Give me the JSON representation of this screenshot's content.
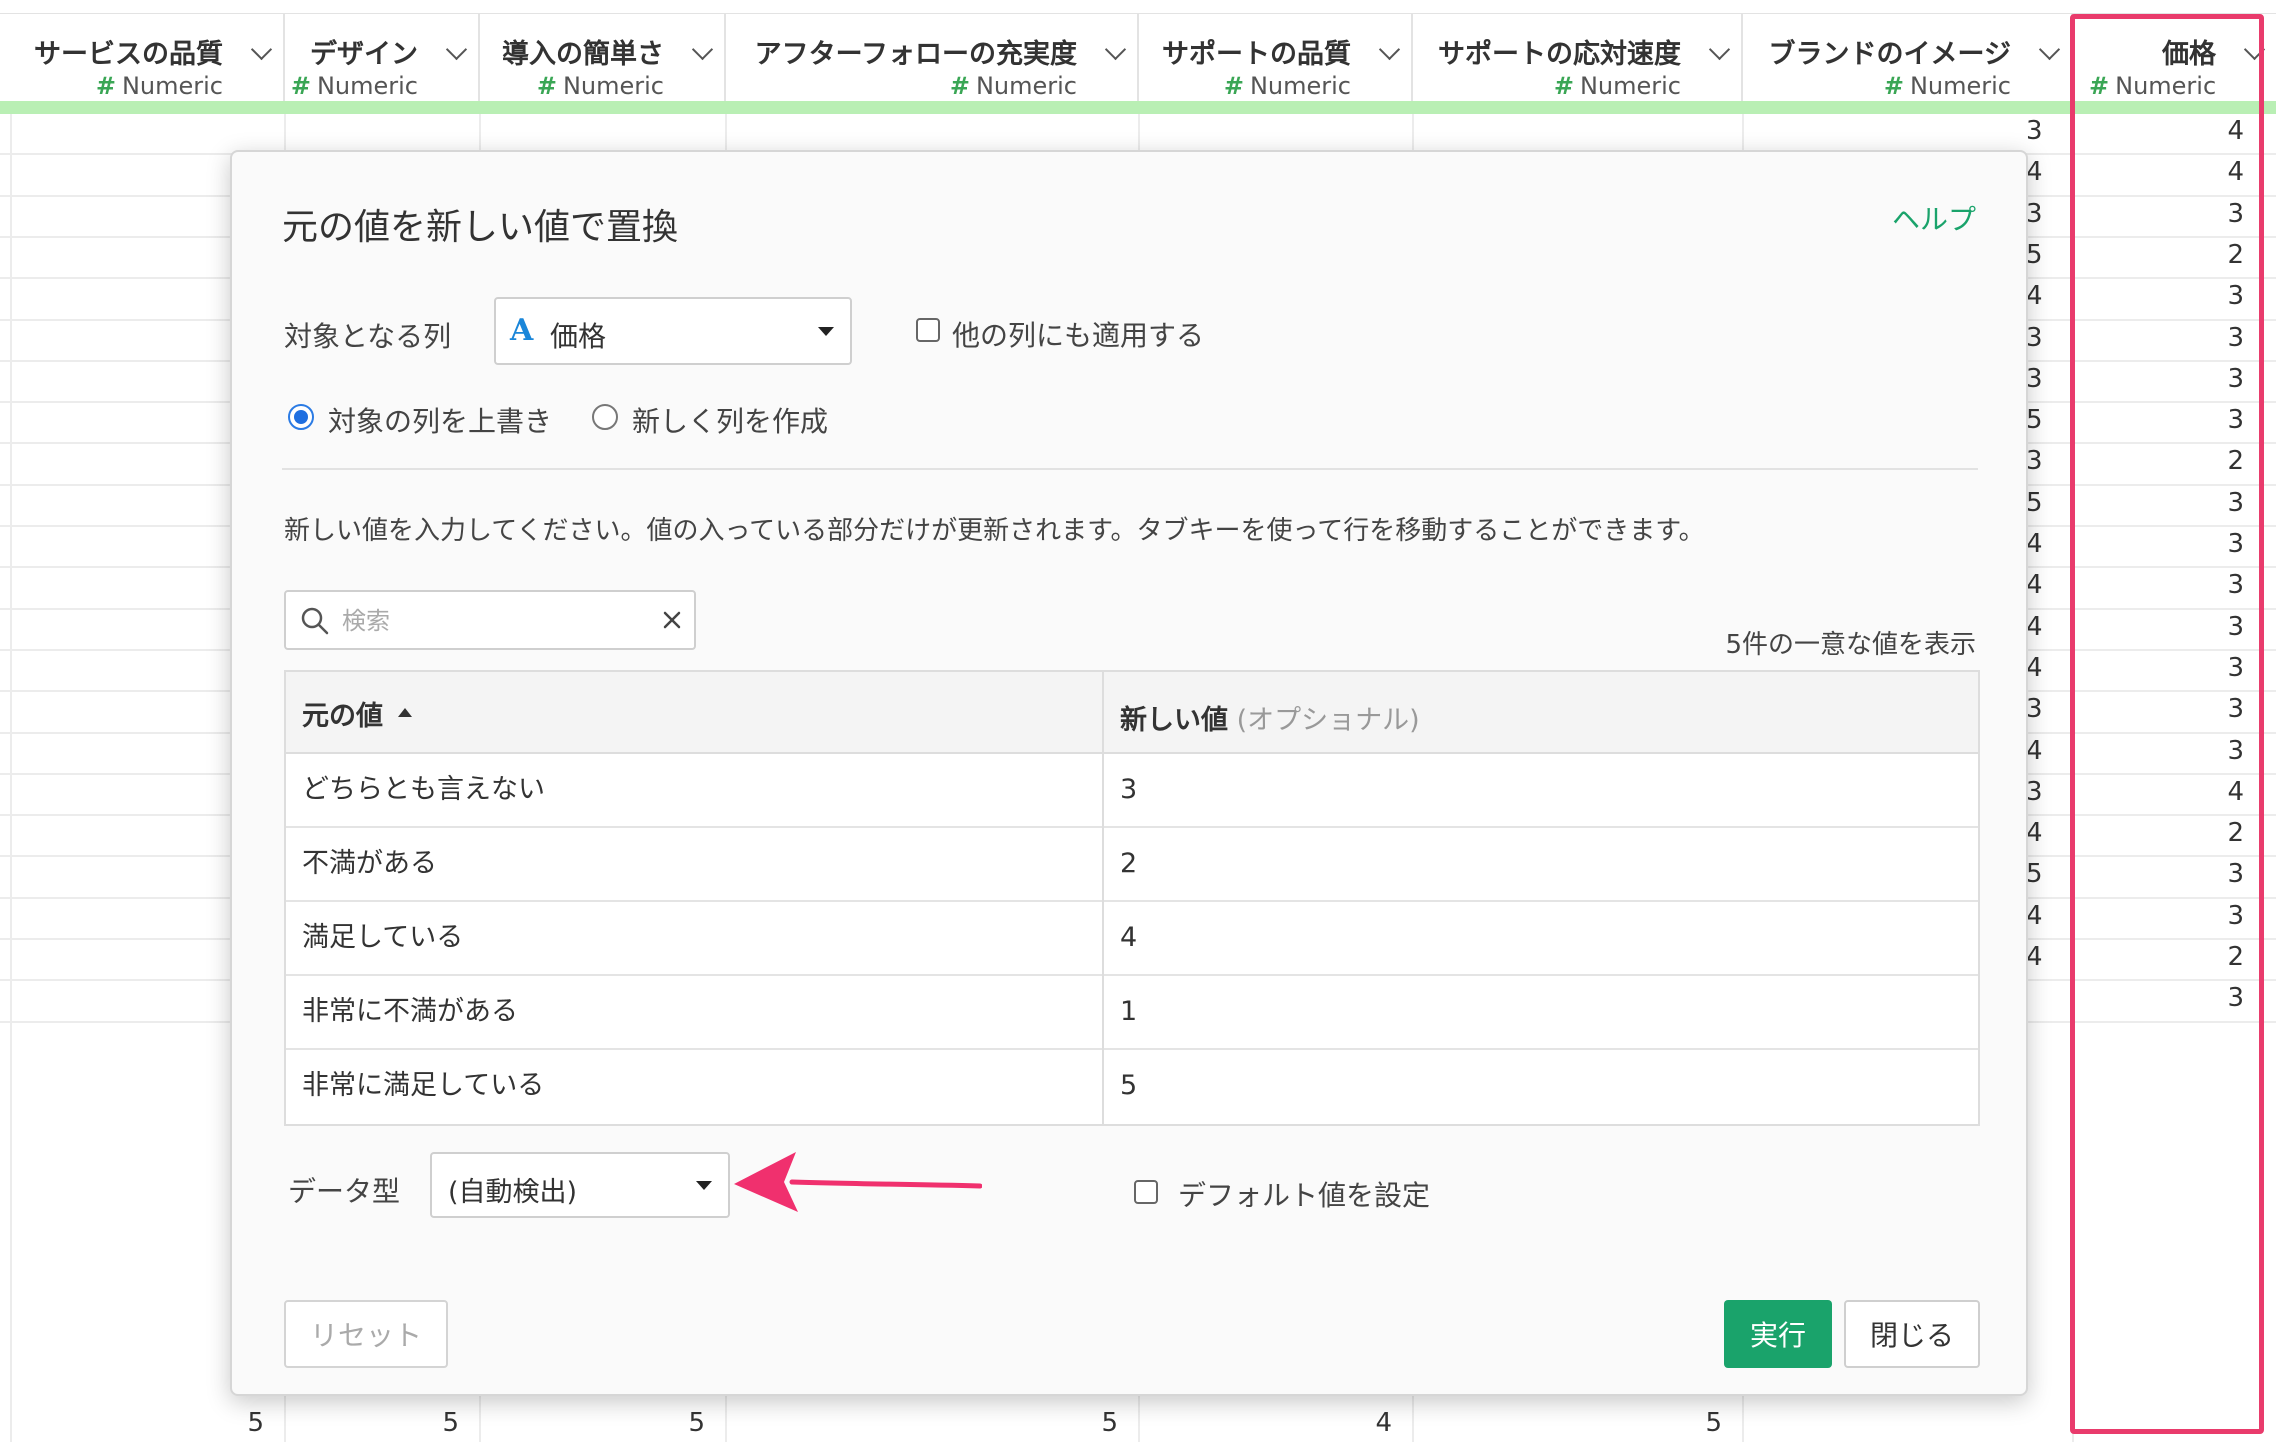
{
  "columns": [
    {
      "name": "サービスの品質",
      "type": "Numeric"
    },
    {
      "name": "デザイン",
      "type": "Numeric"
    },
    {
      "name": "導入の簡単さ",
      "type": "Numeric"
    },
    {
      "name": "アフターフォローの充実度",
      "type": "Numeric"
    },
    {
      "name": "サポートの品質",
      "type": "Numeric"
    },
    {
      "name": "サポートの応対速度",
      "type": "Numeric"
    },
    {
      "name": "ブランドのイメージ",
      "type": "Numeric"
    },
    {
      "name": "価格",
      "type": "Numeric"
    }
  ],
  "type_symbol": "#",
  "brand_column_values": [
    "3",
    "4",
    "3",
    "5",
    "4",
    "3",
    "3",
    "5",
    "3",
    "5",
    "4",
    "4",
    "4",
    "4",
    "3",
    "4",
    "3",
    "4",
    "5",
    "4",
    "4"
  ],
  "price_column_values": [
    "4",
    "4",
    "3",
    "2",
    "3",
    "3",
    "3",
    "3",
    "2",
    "3",
    "3",
    "3",
    "3",
    "3",
    "3",
    "3",
    "4",
    "2",
    "3",
    "3",
    "2",
    "3"
  ],
  "bottom_row": [
    "5",
    "5",
    "5",
    "5",
    "4",
    "5"
  ],
  "dialog": {
    "title": "元の値を新しい値で置換",
    "help": "ヘルプ",
    "target_column_label": "対象となる列",
    "target_column_type_icon": "A",
    "target_column_value": "価格",
    "apply_other_columns": "他の列にも適用する",
    "radio_overwrite": "対象の列を上書き",
    "radio_new_column": "新しく列を作成",
    "instruction": "新しい値を入力してください。値の入っている部分だけが更新されます。タブキーを使って行を移動することができます。",
    "search_placeholder": "検索",
    "unique_count": "5件の一意な値を表示",
    "table": {
      "header_original": "元の値",
      "header_new": "新しい値",
      "header_new_hint": "(オプショナル)",
      "rows": [
        {
          "original": "どちらとも言えない",
          "new": "3"
        },
        {
          "original": "不満がある",
          "new": "2"
        },
        {
          "original": "満足している",
          "new": "4"
        },
        {
          "original": "非常に不満がある",
          "new": "1"
        },
        {
          "original": "非常に満足している",
          "new": "5"
        }
      ]
    },
    "data_type_label": "データ型",
    "data_type_value": "(自動検出)",
    "default_value_label": "デフォルト値を設定",
    "reset_button": "リセット",
    "run_button": "実行",
    "close_button": "閉じる"
  },
  "colors": {
    "accent_green": "#1aa36b",
    "header_bar_green": "#b9efb4",
    "highlight_red": "#e93b6c",
    "arrow_pink": "#f0306e",
    "radio_blue": "#1f6fe0"
  }
}
